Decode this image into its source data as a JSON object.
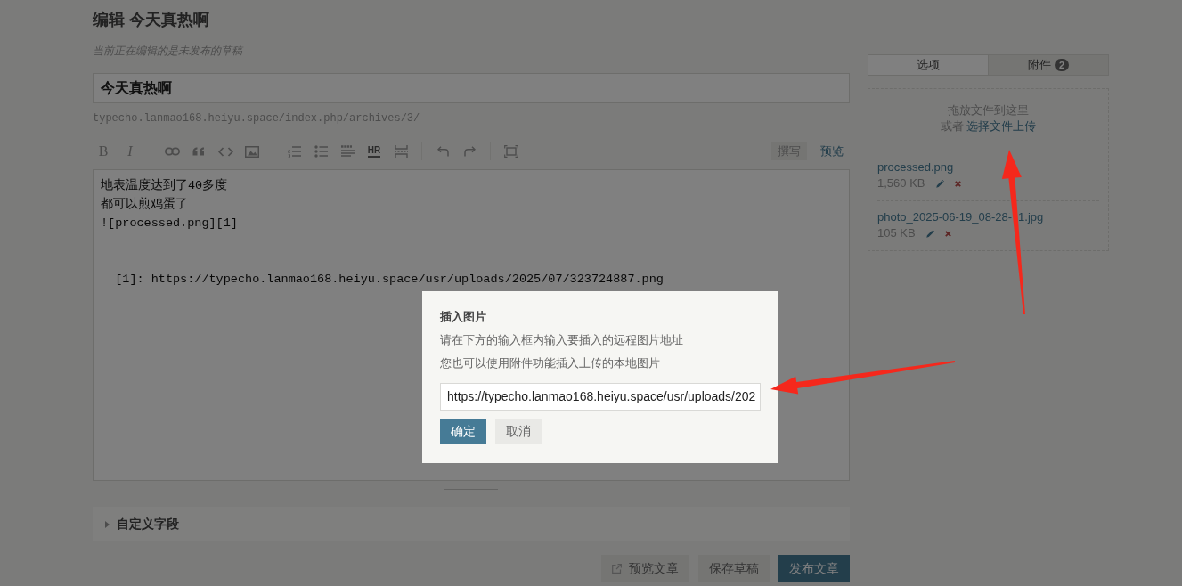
{
  "page": {
    "title": "编辑 今天真热啊",
    "subtitle": "当前正在编辑的是未发布的草稿"
  },
  "post": {
    "title": "今天真热啊",
    "permalink": "typecho.lanmao168.heiyu.space/index.php/archives/3/"
  },
  "editor_toolbar": {
    "bold_label": "B",
    "italic_label": "I",
    "hr_label": "HR",
    "modes": [
      {
        "label": "撰写",
        "selected": true
      },
      {
        "label": "预览",
        "selected": false
      }
    ]
  },
  "editor": {
    "lines": [
      "地表温度达到了40多度",
      "都可以煎鸡蛋了",
      "![processed.png][1]"
    ],
    "reference": "  [1]: https://typecho.lanmao168.heiyu.space/usr/uploads/2025/07/323724887.png"
  },
  "custom_fields": {
    "label": "自定义字段",
    "expanded": false
  },
  "actions": [
    {
      "kind": "preview",
      "label": "预览文章"
    },
    {
      "kind": "save",
      "label": "保存草稿"
    },
    {
      "kind": "publish",
      "label": "发布文章"
    }
  ],
  "sidebar": {
    "tabs": [
      {
        "label": "选项",
        "selected": false
      },
      {
        "label": "附件",
        "selected": true,
        "count": "2"
      }
    ],
    "upload": {
      "hint": "拖放文件到这里",
      "prefix": "或者",
      "link": "选择文件上传"
    },
    "attachments": [
      {
        "name_visible_parts": [
          "processed.png"
        ],
        "size": "1,560 KB"
      },
      {
        "name_visible_parts": [
          "photo_2025-06-19_08-28-",
          "1.jpg"
        ],
        "size": "105 KB"
      }
    ]
  },
  "dialog": {
    "title": "插入图片",
    "lines": [
      "请在下方的输入框内输入要插入的远程图片地址",
      "您也可以使用附件功能插入上传的本地图片"
    ],
    "url_value": "https://typecho.lanmao168.heiyu.space/usr/uploads/202",
    "buttons": [
      {
        "kind": "primary",
        "label": "确定"
      },
      {
        "kind": "secondary",
        "label": "取消"
      }
    ]
  }
}
